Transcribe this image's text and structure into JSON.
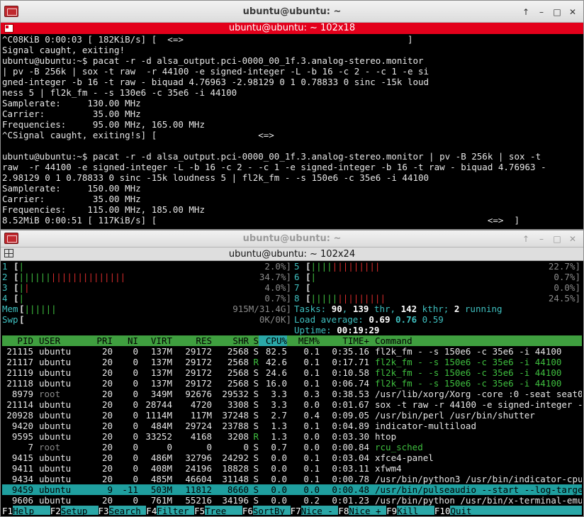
{
  "win1": {
    "title": "ubuntu@ubuntu: ~",
    "buttons": [
      "↑",
      "–",
      "□",
      "✕"
    ],
    "term_title": "ubuntu@ubuntu: ~ 102x18",
    "lines": [
      "^C08KiB 0:00:03 [ 182KiB/s] [  <=>                                          ]",
      "Signal caught, exiting!",
      "ubuntu@ubuntu:~$ pacat -r -d alsa_output.pci-0000_00_1f.3.analog-stereo.monitor",
      "| pv -B 256k | sox -t raw  -r 44100 -e signed-integer -L -b 16 -c 2 - -c 1 -e si",
      "gned-integer -b 16 -t raw - biquad 4.76963 -2.98129 0 1 0.78833 0 sinc -15k loud",
      "ness 5 | fl2k_fm - -s 130e6 -c 35e6 -i 44100",
      "Samplerate:     130.00 MHz",
      "Carrier:         35.00 MHz",
      "Frequencies:     95.00 MHz, 165.00 MHz",
      "^CSignal caught, exiting!s] [                   <=>",
      "",
      "ubuntu@ubuntu:~$ pacat -r -d alsa_output.pci-0000_00_1f.3.analog-stereo.monitor | pv -B 256k | sox -t",
      "raw  -r 44100 -e signed-integer -L -b 16 -c 2 - -c 1 -e signed-integer -b 16 -t raw - biquad 4.76963 -",
      "2.98129 0 1 0.78833 0 sinc -15k loudness 5 | fl2k_fm - -s 150e6 -c 35e6 -i 44100",
      "Samplerate:     150.00 MHz",
      "Carrier:         35.00 MHz",
      "Frequencies:    115.00 MHz, 185.00 MHz",
      "8.52MiB 0:00:51 [ 117KiB/s] [                                                              <=>  ]"
    ]
  },
  "win2": {
    "title": "ubuntu@ubuntu: ~",
    "buttons": [
      "↑",
      "–",
      "□",
      "✕"
    ],
    "term_title": "ubuntu@ubuntu: ~ 102x24",
    "cpus_left": [
      {
        "label": "1",
        "bars": "|",
        "value": "2.0%]",
        "fill": 0.02
      },
      {
        "label": "2",
        "bars": "||||||||||||||||||||",
        "value": "34.7%]",
        "fill": 0.347
      },
      {
        "label": "3",
        "bars": "||",
        "value": "4.0%]",
        "fill": 0.04
      },
      {
        "label": "4",
        "bars": "|",
        "value": "0.7%]",
        "fill": 0.007
      }
    ],
    "cpus_right": [
      {
        "label": "5",
        "bars": "|||||||||||||",
        "value": "22.7%]",
        "fill": 0.227
      },
      {
        "label": "6",
        "bars": "|",
        "value": "0.7%]",
        "fill": 0.007
      },
      {
        "label": "7",
        "bars": "",
        "value": "0.0%]",
        "fill": 0.0
      },
      {
        "label": "8",
        "bars": "||||||||||||||",
        "value": "24.5%]",
        "fill": 0.245
      }
    ],
    "mem": {
      "label": "Mem",
      "bars": "||||||",
      "value": "915M/31.4G]"
    },
    "swp": {
      "label": "Swp",
      "bars": "",
      "value": "0K/0K]"
    },
    "tasks": {
      "prefix": "Tasks:",
      "tasks": "90",
      "thr": "139",
      "thr_label": "thr,",
      "kthr": "142",
      "kthr_label": "kthr;",
      "running": "2",
      "running_label": "running"
    },
    "load": {
      "prefix": "Load average:",
      "one": "0.69",
      "five": "0.76",
      "fifteen": "0.59"
    },
    "uptime": {
      "prefix": "Uptime:",
      "value": "00:19:29"
    },
    "headers": [
      "PID",
      "USER",
      "PRI",
      "NI",
      "VIRT",
      "RES",
      "SHR",
      "S",
      "CPU%",
      "MEM%",
      "TIME+",
      "Command"
    ],
    "processes": [
      {
        "pid": "21115",
        "user": "ubuntu",
        "pri": "20",
        "ni": "0",
        "virt": "137M",
        "res": "29172",
        "shr": "2568",
        "s": "S",
        "cpu": "82.5",
        "mem": "0.1",
        "time": "0:35.16",
        "cmd": "fl2k_fm - -s 150e6 -c 35e6 -i 44100",
        "style": "normal"
      },
      {
        "pid": "21117",
        "user": "ubuntu",
        "pri": "20",
        "ni": "0",
        "virt": "137M",
        "res": "29172",
        "shr": "2568",
        "s": "R",
        "cpu": "42.6",
        "mem": "0.1",
        "time": "0:17.71",
        "cmd": "fl2k_fm - -s 150e6 -c 35e6 -i 44100",
        "style": "thread"
      },
      {
        "pid": "21119",
        "user": "ubuntu",
        "pri": "20",
        "ni": "0",
        "virt": "137M",
        "res": "29172",
        "shr": "2568",
        "s": "S",
        "cpu": "24.6",
        "mem": "0.1",
        "time": "0:10.58",
        "cmd": "fl2k_fm - -s 150e6 -c 35e6 -i 44100",
        "style": "thread"
      },
      {
        "pid": "21118",
        "user": "ubuntu",
        "pri": "20",
        "ni": "0",
        "virt": "137M",
        "res": "29172",
        "shr": "2568",
        "s": "S",
        "cpu": "16.0",
        "mem": "0.1",
        "time": "0:06.74",
        "cmd": "fl2k_fm - -s 150e6 -c 35e6 -i 44100",
        "style": "thread"
      },
      {
        "pid": "8979",
        "user": "root",
        "pri": "20",
        "ni": "0",
        "virt": "349M",
        "res": "92676",
        "shr": "29532",
        "s": "S",
        "cpu": "3.3",
        "mem": "0.3",
        "time": "0:38.53",
        "cmd": "/usr/lib/xorg/Xorg -core :0 -seat seat0",
        "style": "root"
      },
      {
        "pid": "21114",
        "user": "ubuntu",
        "pri": "20",
        "ni": "0",
        "virt": "28744",
        "res": "4720",
        "shr": "3308",
        "s": "S",
        "cpu": "3.3",
        "mem": "0.0",
        "time": "0:01.67",
        "cmd": "sox -t raw -r 44100 -e signed-integer -",
        "style": "normal"
      },
      {
        "pid": "20928",
        "user": "ubuntu",
        "pri": "20",
        "ni": "0",
        "virt": "1114M",
        "res": "117M",
        "shr": "37248",
        "s": "S",
        "cpu": "2.7",
        "mem": "0.4",
        "time": "0:09.05",
        "cmd": "/usr/bin/perl /usr/bin/shutter",
        "style": "normal"
      },
      {
        "pid": "9420",
        "user": "ubuntu",
        "pri": "20",
        "ni": "0",
        "virt": "484M",
        "res": "29724",
        "shr": "23788",
        "s": "S",
        "cpu": "1.3",
        "mem": "0.1",
        "time": "0:04.89",
        "cmd": "indicator-multiload",
        "style": "normal"
      },
      {
        "pid": "9595",
        "user": "ubuntu",
        "pri": "20",
        "ni": "0",
        "virt": "33252",
        "res": "4168",
        "shr": "3208",
        "s": "R",
        "cpu": "1.3",
        "mem": "0.0",
        "time": "0:03.30",
        "cmd": "htop",
        "style": "normal"
      },
      {
        "pid": "7",
        "user": "root",
        "pri": "20",
        "ni": "0",
        "virt": "0",
        "res": "0",
        "shr": "0",
        "s": "S",
        "cpu": "0.7",
        "mem": "0.0",
        "time": "0:00.84",
        "cmd": "rcu_sched",
        "style": "kernel"
      },
      {
        "pid": "9415",
        "user": "ubuntu",
        "pri": "20",
        "ni": "0",
        "virt": "486M",
        "res": "32796",
        "shr": "24292",
        "s": "S",
        "cpu": "0.0",
        "mem": "0.1",
        "time": "0:03.04",
        "cmd": "xfce4-panel",
        "style": "normal"
      },
      {
        "pid": "9411",
        "user": "ubuntu",
        "pri": "20",
        "ni": "0",
        "virt": "408M",
        "res": "24196",
        "shr": "18828",
        "s": "S",
        "cpu": "0.0",
        "mem": "0.1",
        "time": "0:03.11",
        "cmd": "xfwm4",
        "style": "normal"
      },
      {
        "pid": "9434",
        "user": "ubuntu",
        "pri": "20",
        "ni": "0",
        "virt": "485M",
        "res": "46604",
        "shr": "31148",
        "s": "S",
        "cpu": "0.0",
        "mem": "0.1",
        "time": "0:00.78",
        "cmd": "/usr/bin/python3 /usr/bin/indicator-cpu",
        "style": "normal"
      },
      {
        "pid": "9459",
        "user": "ubuntu",
        "pri": "9",
        "ni": "-11",
        "virt": "503M",
        "res": "11812",
        "shr": "8660",
        "s": "S",
        "cpu": "0.0",
        "mem": "0.0",
        "time": "0:00.48",
        "cmd": "/usr/bin/pulseaudio --start --log-targe",
        "style": "selected"
      },
      {
        "pid": "9606",
        "user": "ubuntu",
        "pri": "20",
        "ni": "0",
        "virt": "761M",
        "res": "55216",
        "shr": "34196",
        "s": "S",
        "cpu": "0.0",
        "mem": "0.2",
        "time": "0:01.23",
        "cmd": "/usr/bin/python /usr/bin/x-terminal-emu",
        "style": "normal"
      }
    ],
    "fkeys": [
      {
        "key": "F1",
        "label": "Help"
      },
      {
        "key": "F2",
        "label": "Setup"
      },
      {
        "key": "F3",
        "label": "Search"
      },
      {
        "key": "F4",
        "label": "Filter"
      },
      {
        "key": "F5",
        "label": "Tree"
      },
      {
        "key": "F6",
        "label": "SortBy"
      },
      {
        "key": "F7",
        "label": "Nice -"
      },
      {
        "key": "F8",
        "label": "Nice +"
      },
      {
        "key": "F9",
        "label": "Kill"
      },
      {
        "key": "F10",
        "label": "Quit"
      }
    ]
  }
}
